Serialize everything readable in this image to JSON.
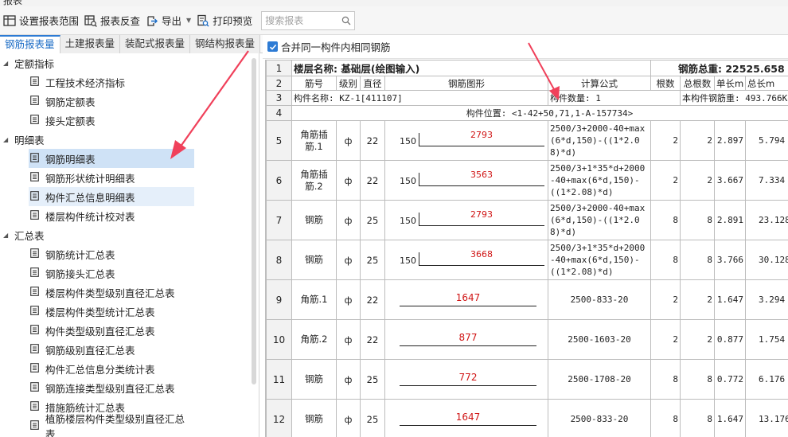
{
  "window": {
    "title": "报表"
  },
  "toolbar": {
    "setup_label": "设置报表范围",
    "reverse_label": "报表反查",
    "export_label": "导出",
    "print_label": "打印预览",
    "search_placeholder": "搜索报表"
  },
  "tabs": [
    "钢筋报表量",
    "土建报表量",
    "装配式报表量",
    "钢结构报表量"
  ],
  "tree": {
    "group1": "定额指标",
    "group1_items": [
      "工程技术经济指标",
      "钢筋定额表",
      "接头定额表"
    ],
    "group2": "明细表",
    "group2_items": [
      "钢筋明细表",
      "钢筋形状统计明细表",
      "构件汇总信息明细表",
      "楼层构件统计校对表"
    ],
    "group3": "汇总表",
    "group3_items": [
      "钢筋统计汇总表",
      "钢筋接头汇总表",
      "楼层构件类型级别直径汇总表",
      "楼层构件类型统计汇总表",
      "构件类型级别直径汇总表",
      "钢筋级别直径汇总表",
      "构件汇总信息分类统计表",
      "钢筋连接类型级别直径汇总表",
      "措施筋统计汇总表",
      "植筋楼层构件类型级别直径汇总表"
    ]
  },
  "option": {
    "merge_label": "合并同一构件内相同钢筋",
    "checked": true
  },
  "sheet": {
    "row_numbers": [
      "1",
      "2",
      "3",
      "4",
      "5",
      "6",
      "7",
      "8",
      "9",
      "10",
      "11",
      "12"
    ],
    "floor_label": "楼层名称: 基础层(绘图输入)",
    "total_weight": "钢筋总重: 22525.658",
    "headers": [
      "筋号",
      "级别",
      "直径",
      "钢筋图形",
      "计算公式",
      "根数",
      "总根数",
      "单长m",
      "总长m"
    ],
    "component_name": "构件名称: KZ-1[411107]",
    "component_count": "构件数量: 1",
    "component_weight": "本构件钢筋重: 493.766Kg",
    "component_position": "构件位置: <1-42+50,71,1-A-157734>",
    "grade_symbol": "ф",
    "rows": [
      {
        "id": "角筋插筋.1",
        "dia": "22",
        "hook": "150",
        "len": "2793",
        "formula": "2500/3+2000-40+max(6*d,150)-((1*2.08)*d)",
        "count": "2",
        "total": "2",
        "unit": "2.897",
        "sum": "5.794"
      },
      {
        "id": "角筋插筋.2",
        "dia": "22",
        "hook": "150",
        "len": "3563",
        "formula": "2500/3+1*35*d+2000-40+max(6*d,150)-((1*2.08)*d)",
        "count": "2",
        "total": "2",
        "unit": "3.667",
        "sum": "7.334"
      },
      {
        "id": "钢筋",
        "dia": "25",
        "hook": "150",
        "len": "2793",
        "formula": "2500/3+2000-40+max(6*d,150)-((1*2.08)*d)",
        "count": "8",
        "total": "8",
        "unit": "2.891",
        "sum": "23.128"
      },
      {
        "id": "钢筋",
        "dia": "25",
        "hook": "150",
        "len": "3668",
        "formula": "2500/3+1*35*d+2000-40+max(6*d,150)-((1*2.08)*d)",
        "count": "8",
        "total": "8",
        "unit": "3.766",
        "sum": "30.128"
      },
      {
        "id": "角筋.1",
        "dia": "22",
        "hook": "",
        "len": "1647",
        "formula": "2500-833-20",
        "count": "2",
        "total": "2",
        "unit": "1.647",
        "sum": "3.294"
      },
      {
        "id": "角筋.2",
        "dia": "22",
        "hook": "",
        "len": "877",
        "formula": "2500-1603-20",
        "count": "2",
        "total": "2",
        "unit": "0.877",
        "sum": "1.754"
      },
      {
        "id": "钢筋",
        "dia": "25",
        "hook": "",
        "len": "772",
        "formula": "2500-1708-20",
        "count": "8",
        "total": "8",
        "unit": "0.772",
        "sum": "6.176"
      },
      {
        "id": "钢筋",
        "dia": "25",
        "hook": "",
        "len": "1647",
        "formula": "2500-833-20",
        "count": "8",
        "total": "8",
        "unit": "1.647",
        "sum": "13.176"
      }
    ]
  },
  "colors": {
    "accent": "#2d7bd4",
    "selected": "#cfe2f6",
    "arrow": "#f0405a",
    "length_text": "#d01515"
  }
}
